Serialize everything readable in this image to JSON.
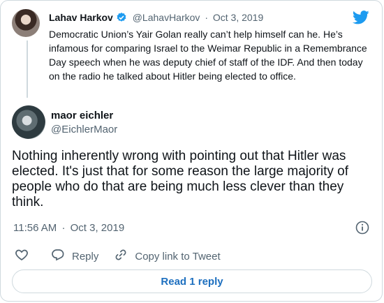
{
  "parent_tweet": {
    "author_name": "Lahav Harkov",
    "handle": "@LahavHarkov",
    "separator": "·",
    "date": "Oct 3, 2019",
    "text": "Democratic Union’s Yair Golan really can’t help himself can he. He’s infamous for comparing Israel to the Weimar Republic in a Remembrance Day speech when he was deputy chief of staff of the IDF. And then today on the radio he talked about Hitler being elected to office."
  },
  "tweet": {
    "author_name": "maor eichler",
    "handle": "@EichlerMaor",
    "text": "Nothing inherently wrong with pointing out that Hitler was elected. It's just that for some reason the large majority of people who do that are being much less clever than they think.",
    "time": "11:56 AM",
    "separator": "·",
    "date": "Oct 3, 2019"
  },
  "actions": {
    "reply_label": "Reply",
    "copy_link_label": "Copy link to Tweet"
  },
  "read_replies_label": "Read 1 reply",
  "colors": {
    "twitter_blue": "#1d9bf0",
    "link_blue": "#1d6fbf",
    "muted": "#536471",
    "border": "#cfd9de"
  },
  "icons": [
    "verified-badge-icon",
    "twitter-bird-icon",
    "info-icon",
    "heart-icon",
    "reply-icon",
    "link-icon"
  ]
}
